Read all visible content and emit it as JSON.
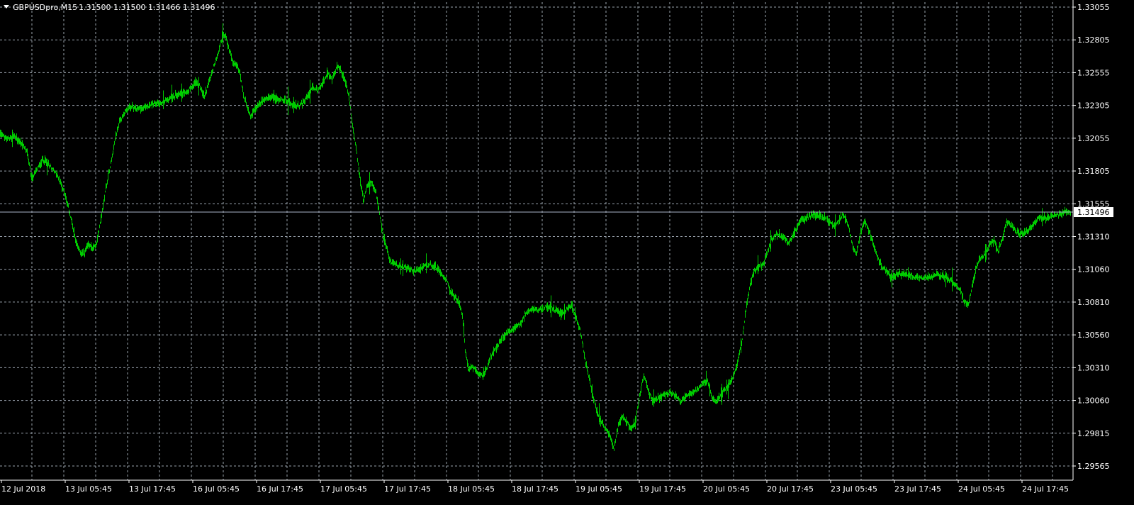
{
  "window": {
    "symbol_timeframe": "GBPUSDpro,M15",
    "ohlc": "1.31500 1.31500 1.31466 1.31496"
  },
  "colors": {
    "background": "#000000",
    "grid": "#9aa3ad",
    "axis": "#ffffff",
    "bars": "#00cc00",
    "bid_line": "#aab4c8",
    "price_tag_bg": "#ffffff",
    "price_tag_text": "#000000"
  },
  "chart_data": {
    "type": "line",
    "style": "ohlc-bars",
    "grid": true,
    "ylim": [
      1.29565,
      1.33055
    ],
    "y_ticks": [
      "1.33055",
      "1.32805",
      "1.32555",
      "1.32305",
      "1.32055",
      "1.31805",
      "1.31555",
      "1.31310",
      "1.31060",
      "1.30810",
      "1.30560",
      "1.30310",
      "1.30060",
      "1.29815",
      "1.29565"
    ],
    "x_ticks": [
      "12 Jul 2018",
      "13 Jul 05:45",
      "13 Jul 17:45",
      "16 Jul 05:45",
      "16 Jul 17:45",
      "17 Jul 05:45",
      "17 Jul 17:45",
      "18 Jul 05:45",
      "18 Jul 17:45",
      "19 Jul 05:45",
      "19 Jul 17:45",
      "20 Jul 05:45",
      "20 Jul 17:45",
      "23 Jul 05:45",
      "23 Jul 17:45",
      "24 Jul 05:45",
      "24 Jul 17:45"
    ],
    "current_price": 1.31496,
    "current_price_label": "1.31496",
    "series": [
      {
        "points": [
          [
            0,
            1.3209
          ],
          [
            10,
            1.3205
          ],
          [
            20,
            1.3207
          ],
          [
            30,
            1.3202
          ],
          [
            38,
            1.3195
          ],
          [
            44,
            1.3175
          ],
          [
            50,
            1.318
          ],
          [
            60,
            1.319
          ],
          [
            70,
            1.3185
          ],
          [
            80,
            1.3178
          ],
          [
            90,
            1.3165
          ],
          [
            100,
            1.3145
          ],
          [
            106,
            1.3128
          ],
          [
            112,
            1.312
          ],
          [
            118,
            1.3118
          ],
          [
            124,
            1.3125
          ],
          [
            130,
            1.3122
          ],
          [
            136,
            1.3125
          ],
          [
            142,
            1.3145
          ],
          [
            148,
            1.3165
          ],
          [
            155,
            1.3185
          ],
          [
            162,
            1.3205
          ],
          [
            168,
            1.3218
          ],
          [
            175,
            1.3225
          ],
          [
            185,
            1.323
          ],
          [
            195,
            1.3228
          ],
          [
            205,
            1.323
          ],
          [
            215,
            1.3232
          ],
          [
            225,
            1.3232
          ],
          [
            235,
            1.3235
          ],
          [
            245,
            1.3238
          ],
          [
            255,
            1.324
          ],
          [
            265,
            1.3242
          ],
          [
            275,
            1.3248
          ],
          [
            282,
            1.3245
          ],
          [
            288,
            1.3237
          ],
          [
            295,
            1.325
          ],
          [
            302,
            1.3262
          ],
          [
            308,
            1.3272
          ],
          [
            314,
            1.3285
          ],
          [
            318,
            1.3283
          ],
          [
            322,
            1.3274
          ],
          [
            328,
            1.3265
          ],
          [
            333,
            1.3262
          ],
          [
            338,
            1.3255
          ],
          [
            343,
            1.3238
          ],
          [
            348,
            1.323
          ],
          [
            354,
            1.3222
          ],
          [
            362,
            1.323
          ],
          [
            372,
            1.3235
          ],
          [
            382,
            1.3238
          ],
          [
            392,
            1.3235
          ],
          [
            402,
            1.3235
          ],
          [
            412,
            1.3232
          ],
          [
            422,
            1.323
          ],
          [
            432,
            1.3236
          ],
          [
            440,
            1.3245
          ],
          [
            448,
            1.3242
          ],
          [
            455,
            1.3248
          ],
          [
            462,
            1.3255
          ],
          [
            468,
            1.325
          ],
          [
            475,
            1.326
          ],
          [
            480,
            1.3258
          ],
          [
            486,
            1.325
          ],
          [
            492,
            1.3238
          ],
          [
            497,
            1.3215
          ],
          [
            502,
            1.3198
          ],
          [
            507,
            1.3178
          ],
          [
            512,
            1.3158
          ],
          [
            518,
            1.317
          ],
          [
            524,
            1.3172
          ],
          [
            530,
            1.3165
          ],
          [
            535,
            1.3148
          ],
          [
            540,
            1.3132
          ],
          [
            545,
            1.3122
          ],
          [
            550,
            1.3112
          ],
          [
            558,
            1.311
          ],
          [
            566,
            1.3108
          ],
          [
            574,
            1.3107
          ],
          [
            582,
            1.3105
          ],
          [
            590,
            1.3106
          ],
          [
            598,
            1.3108
          ],
          [
            606,
            1.311
          ],
          [
            614,
            1.3108
          ],
          [
            622,
            1.3103
          ],
          [
            630,
            1.3098
          ],
          [
            636,
            1.3088
          ],
          [
            642,
            1.3085
          ],
          [
            648,
            1.308
          ],
          [
            652,
            1.307
          ],
          [
            656,
            1.3045
          ],
          [
            660,
            1.303
          ],
          [
            665,
            1.3032
          ],
          [
            670,
            1.303
          ],
          [
            675,
            1.3025
          ],
          [
            680,
            1.3025
          ],
          [
            686,
            1.303
          ],
          [
            692,
            1.304
          ],
          [
            698,
            1.3045
          ],
          [
            704,
            1.305
          ],
          [
            710,
            1.3055
          ],
          [
            716,
            1.3058
          ],
          [
            722,
            1.306
          ],
          [
            728,
            1.3062
          ],
          [
            734,
            1.3065
          ],
          [
            740,
            1.3072
          ],
          [
            746,
            1.3075
          ],
          [
            752,
            1.3076
          ],
          [
            760,
            1.3075
          ],
          [
            768,
            1.3077
          ],
          [
            776,
            1.3077
          ],
          [
            784,
            1.3075
          ],
          [
            792,
            1.3072
          ],
          [
            800,
            1.3076
          ],
          [
            806,
            1.3078
          ],
          [
            812,
            1.307
          ],
          [
            818,
            1.306
          ],
          [
            824,
            1.304
          ],
          [
            830,
            1.3025
          ],
          [
            836,
            1.301
          ],
          [
            842,
            1.2998
          ],
          [
            848,
            1.299
          ],
          [
            854,
            1.2985
          ],
          [
            860,
            1.298
          ],
          [
            866,
            1.297
          ],
          [
            872,
            1.2988
          ],
          [
            878,
            1.2995
          ],
          [
            884,
            1.299
          ],
          [
            890,
            1.2985
          ],
          [
            896,
            1.299
          ],
          [
            902,
            1.301
          ],
          [
            908,
            1.3025
          ],
          [
            914,
            1.3015
          ],
          [
            920,
            1.3005
          ],
          [
            928,
            1.3008
          ],
          [
            936,
            1.301
          ],
          [
            944,
            1.3012
          ],
          [
            952,
            1.301
          ],
          [
            960,
            1.3005
          ],
          [
            968,
            1.301
          ],
          [
            976,
            1.3012
          ],
          [
            984,
            1.3015
          ],
          [
            992,
            1.302
          ],
          [
            998,
            1.3022
          ],
          [
            1004,
            1.3008
          ],
          [
            1010,
            1.3005
          ],
          [
            1016,
            1.301
          ],
          [
            1022,
            1.3015
          ],
          [
            1028,
            1.3018
          ],
          [
            1034,
            1.3025
          ],
          [
            1040,
            1.3035
          ],
          [
            1046,
            1.305
          ],
          [
            1052,
            1.3075
          ],
          [
            1058,
            1.3095
          ],
          [
            1064,
            1.3105
          ],
          [
            1070,
            1.3108
          ],
          [
            1076,
            1.311
          ],
          [
            1082,
            1.3118
          ],
          [
            1088,
            1.3128
          ],
          [
            1094,
            1.3133
          ],
          [
            1100,
            1.3132
          ],
          [
            1106,
            1.313
          ],
          [
            1112,
            1.3125
          ],
          [
            1118,
            1.3132
          ],
          [
            1124,
            1.3138
          ],
          [
            1130,
            1.3143
          ],
          [
            1138,
            1.3145
          ],
          [
            1146,
            1.3148
          ],
          [
            1154,
            1.3147
          ],
          [
            1162,
            1.3145
          ],
          [
            1170,
            1.3143
          ],
          [
            1178,
            1.3138
          ],
          [
            1184,
            1.3145
          ],
          [
            1190,
            1.3148
          ],
          [
            1196,
            1.314
          ],
          [
            1202,
            1.3125
          ],
          [
            1208,
            1.3118
          ],
          [
            1214,
            1.3135
          ],
          [
            1220,
            1.3142
          ],
          [
            1226,
            1.3135
          ],
          [
            1232,
            1.3125
          ],
          [
            1238,
            1.3115
          ],
          [
            1244,
            1.3108
          ],
          [
            1250,
            1.3105
          ],
          [
            1256,
            1.31
          ],
          [
            1262,
            1.3102
          ],
          [
            1270,
            1.3103
          ],
          [
            1280,
            1.3102
          ],
          [
            1290,
            1.31
          ],
          [
            1300,
            1.31
          ],
          [
            1310,
            1.31
          ],
          [
            1320,
            1.3102
          ],
          [
            1330,
            1.3101
          ],
          [
            1340,
            1.3098
          ],
          [
            1348,
            1.3095
          ],
          [
            1354,
            1.309
          ],
          [
            1360,
            1.3082
          ],
          [
            1366,
            1.308
          ],
          [
            1372,
            1.3095
          ],
          [
            1378,
            1.311
          ],
          [
            1384,
            1.3115
          ],
          [
            1390,
            1.3118
          ],
          [
            1396,
            1.3125
          ],
          [
            1402,
            1.3128
          ],
          [
            1408,
            1.312
          ],
          [
            1414,
            1.313
          ],
          [
            1420,
            1.3142
          ],
          [
            1426,
            1.314
          ],
          [
            1432,
            1.3135
          ],
          [
            1440,
            1.3133
          ],
          [
            1448,
            1.3135
          ],
          [
            1456,
            1.3138
          ],
          [
            1464,
            1.3145
          ],
          [
            1472,
            1.3145
          ],
          [
            1480,
            1.3145
          ],
          [
            1488,
            1.3147
          ],
          [
            1496,
            1.3148
          ],
          [
            1502,
            1.315
          ],
          [
            1506,
            1.315
          ],
          [
            1510,
            1.3149
          ]
        ]
      }
    ]
  }
}
